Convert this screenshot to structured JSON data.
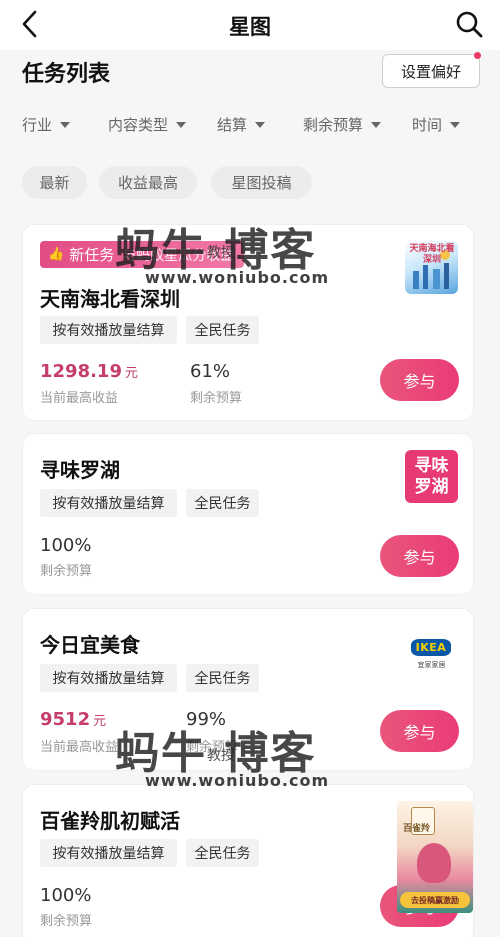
{
  "header": {
    "title": "星图"
  },
  "section": {
    "title": "任务列表",
    "pref_button": "设置偏好"
  },
  "filters": [
    {
      "label": "行业"
    },
    {
      "label": "内容类型"
    },
    {
      "label": "结算"
    },
    {
      "label": "剩余预算"
    },
    {
      "label": "时间"
    }
  ],
  "chips": [
    {
      "label": "最新"
    },
    {
      "label": "收益最高"
    },
    {
      "label": "星图投稿"
    }
  ],
  "cards": [
    {
      "badge": "新任务",
      "badge_sub": "与蚂蚁星瓜分收益",
      "name": "天南海北看深圳",
      "tags": [
        "按有效播放量结算",
        "全民任务"
      ],
      "money": "1298.19",
      "money_unit": "元",
      "money_label": "当前最高收益",
      "budget": "61%",
      "budget_label": "剩余预算",
      "join": "参与",
      "thumb_text": "天南海北看深圳"
    },
    {
      "name": "寻味罗湖",
      "tags": [
        "按有效播放量结算",
        "全民任务"
      ],
      "budget": "100%",
      "budget_label": "剩余预算",
      "join": "参与",
      "thumb_text": "寻味罗湖"
    },
    {
      "name": "今日宜美食",
      "tags": [
        "按有效播放量结算",
        "全民任务"
      ],
      "money": "9512",
      "money_unit": "元",
      "money_label": "当前最高收益",
      "budget": "99%",
      "budget_label": "剩余预算",
      "join": "参与",
      "thumb_text": "IKEA",
      "thumb_sub": "宜家家居"
    },
    {
      "name": "百雀羚肌初赋活",
      "tags": [
        "按有效播放量结算",
        "全民任务"
      ],
      "budget": "100%",
      "budget_label": "剩余预算",
      "join": "参与",
      "thumb_text": "百雀羚",
      "thumb_sub": "去投稿赢激励"
    }
  ],
  "watermark": {
    "main": "蚂牛 博客",
    "sub": "教授",
    "url": "www.woniubo.com"
  },
  "colors": {
    "accent": "#ea3b77",
    "money": "#c53d6a",
    "badge": "#e24b84"
  }
}
